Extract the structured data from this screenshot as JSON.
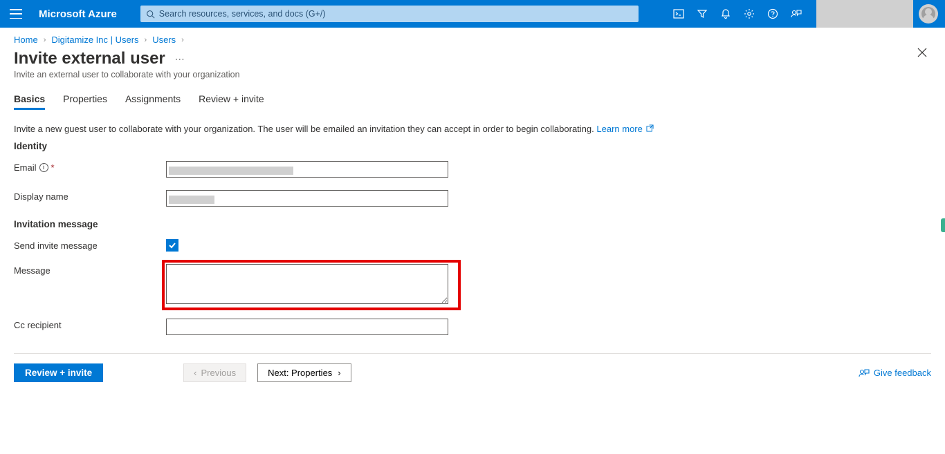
{
  "header": {
    "brand": "Microsoft Azure",
    "search_placeholder": "Search resources, services, and docs (G+/)"
  },
  "breadcrumb": {
    "items": [
      "Home",
      "Digitamize Inc | Users",
      "Users"
    ]
  },
  "page": {
    "title": "Invite external user",
    "subtitle": "Invite an external user to collaborate with your organization"
  },
  "tabs": [
    "Basics",
    "Properties",
    "Assignments",
    "Review + invite"
  ],
  "intro": {
    "text": "Invite a new guest user to collaborate with your organization. The user will be emailed an invitation they can accept in order to begin collaborating.",
    "link": "Learn more"
  },
  "sections": {
    "identity": "Identity",
    "invitation": "Invitation message"
  },
  "fields": {
    "email_label": "Email",
    "email_value": "",
    "display_name_label": "Display name",
    "display_name_value": "",
    "send_invite_label": "Send invite message",
    "send_invite_checked": true,
    "message_label": "Message",
    "message_value": "",
    "cc_label": "Cc recipient",
    "cc_value": ""
  },
  "buttons": {
    "review": "Review + invite",
    "previous": "Previous",
    "next": "Next: Properties",
    "feedback": "Give feedback"
  }
}
